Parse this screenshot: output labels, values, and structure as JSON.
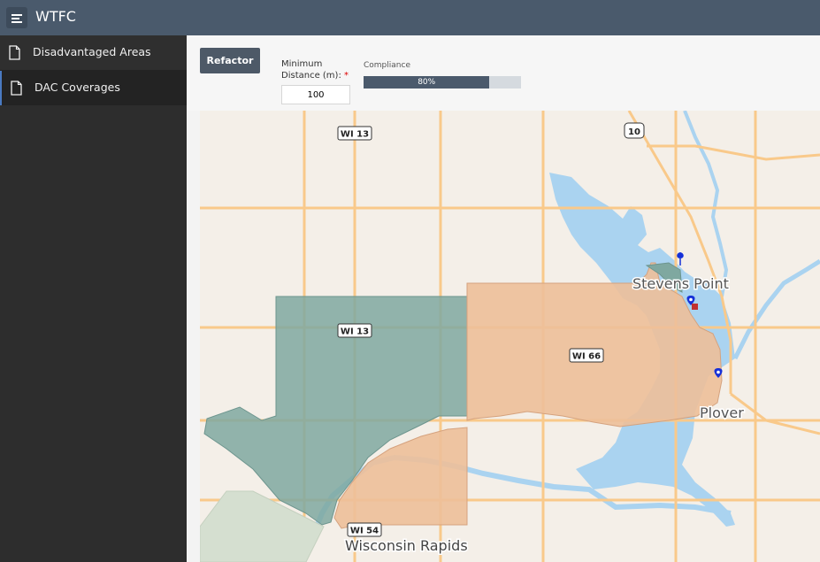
{
  "app": {
    "title": "WTFC",
    "menu_icon": "hamburger-icon"
  },
  "sidebar": {
    "items": [
      {
        "label": "Disadvantaged Areas",
        "icon": "document-icon",
        "active": false
      },
      {
        "label": "DAC Coverages",
        "icon": "document-icon",
        "active": true
      }
    ]
  },
  "toolbar": {
    "refactor_label": "Refactor",
    "min_distance_label_line1": "Minimum",
    "min_distance_label_line2": "Distance (m):",
    "required_marker": "*",
    "min_distance_value": "100",
    "compliance_label": "Compliance",
    "compliance_value": 0.8,
    "compliance_text": "80%"
  },
  "map": {
    "road_labels": [
      "WI 13",
      "10",
      "WI 13",
      "WI 66",
      "WI 54"
    ],
    "place_labels": [
      "Stevens Point",
      "Plover",
      "Wisconsin Rapids"
    ],
    "colors": {
      "land": "#f4efe8",
      "water": "#aad3f0",
      "road": "#f9c98a",
      "teal_area": "#7fa8a0",
      "orange_area": "#edbf99",
      "marker": "#1530d8"
    }
  }
}
